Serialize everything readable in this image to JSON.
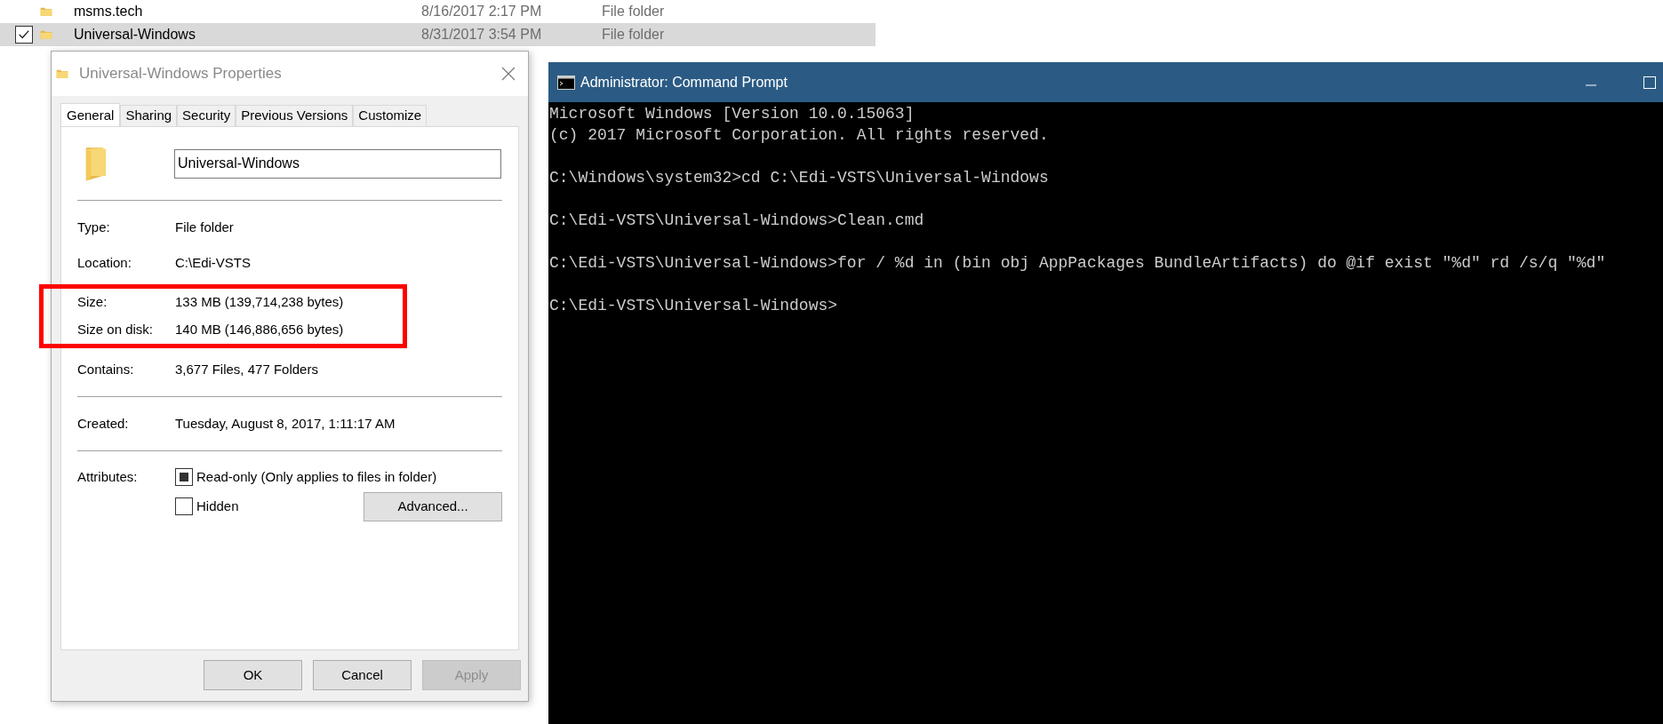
{
  "explorer": {
    "rows": [
      {
        "name": "msms.tech",
        "date": "8/16/2017 2:17 PM",
        "type": "File folder",
        "selected": false
      },
      {
        "name": "Universal-Windows",
        "date": "8/31/2017 3:54 PM",
        "type": "File folder",
        "selected": true
      }
    ]
  },
  "properties_dialog": {
    "title": "Universal-Windows Properties",
    "tabs": [
      {
        "label": "General",
        "selected": true
      },
      {
        "label": "Sharing",
        "selected": false
      },
      {
        "label": "Security",
        "selected": false
      },
      {
        "label": "Previous Versions",
        "selected": false
      },
      {
        "label": "Customize",
        "selected": false
      }
    ],
    "name_field": {
      "value": "Universal-Windows"
    },
    "sections": [
      [
        {
          "label": "Type:",
          "value": "File folder"
        },
        {
          "label": "Location:",
          "value": "C:\\Edi-VSTS"
        },
        {
          "label": "Size:",
          "value": "133 MB (139,714,238 bytes)",
          "highlighted": true
        },
        {
          "label": "Size on disk:",
          "value": "140 MB (146,886,656 bytes)",
          "highlighted": true
        },
        {
          "label": "Contains:",
          "value": "3,677 Files, 477 Folders"
        }
      ],
      [
        {
          "label": "Created:",
          "value": "Tuesday, August 8, 2017, 1:11:17 AM"
        }
      ]
    ],
    "attributes": {
      "label": "Attributes:",
      "checkboxes": [
        {
          "label": "Read-only (Only applies to files in folder)",
          "indeterminate": true
        },
        {
          "label": "Hidden",
          "indeterminate": false
        }
      ],
      "advanced_button": "Advanced..."
    },
    "buttons": [
      {
        "label": "OK",
        "disabled": false
      },
      {
        "label": "Cancel",
        "disabled": false
      },
      {
        "label": "Apply",
        "disabled": true
      }
    ]
  },
  "command_prompt": {
    "title": "Administrator: Command Prompt",
    "blocks": [
      [
        "Microsoft Windows [Version 10.0.15063]",
        "(c) 2017 Microsoft Corporation. All rights reserved."
      ],
      [
        "C:\\Windows\\system32>cd C:\\Edi-VSTS\\Universal-Windows"
      ],
      [
        "C:\\Edi-VSTS\\Universal-Windows>Clean.cmd"
      ],
      [
        "C:\\Edi-VSTS\\Universal-Windows>for / %d in (bin obj AppPackages BundleArtifacts) do @if exist \"%d\" rd /s/q \"%d\""
      ],
      [
        "C:\\Edi-VSTS\\Universal-Windows>"
      ]
    ]
  }
}
